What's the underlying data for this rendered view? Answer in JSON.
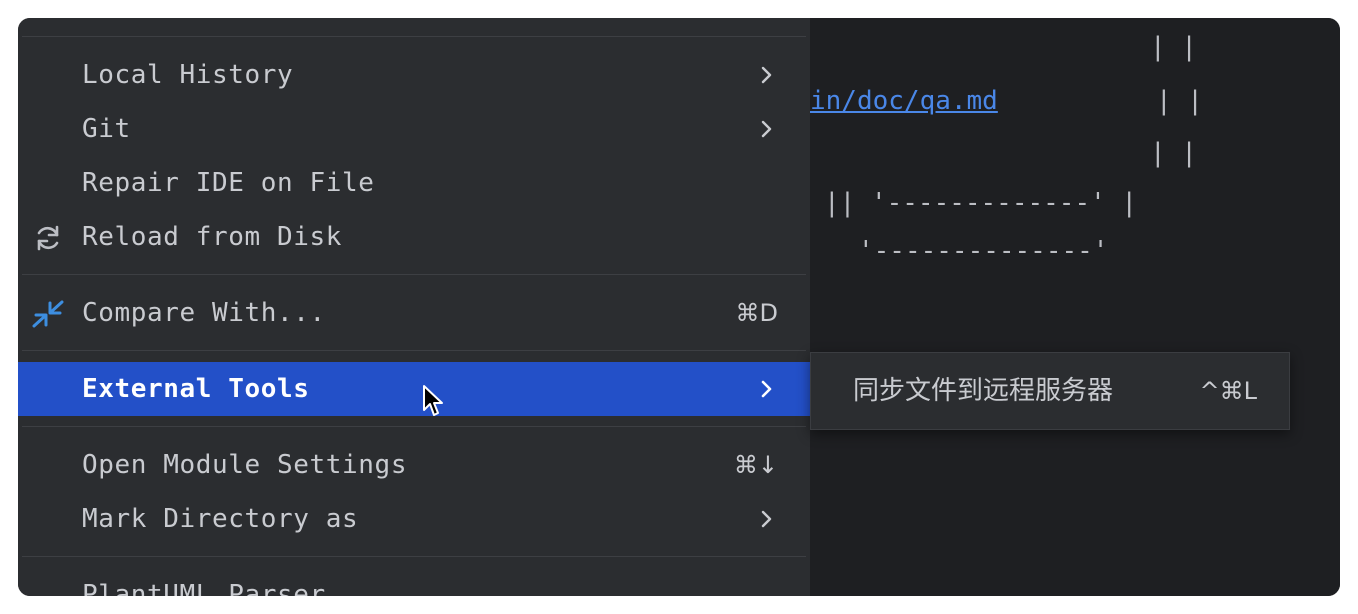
{
  "editor": {
    "lines": [
      "| |",
      "in/doc/qa.md",
      "| |",
      "| |",
      "|| '-------------' |",
      "'--------------'"
    ]
  },
  "menu": {
    "items": [
      {
        "label": "Local History",
        "has_submenu": true
      },
      {
        "label": "Git",
        "has_submenu": true
      },
      {
        "label": "Repair IDE on File"
      },
      {
        "label": "Reload from Disk",
        "icon": "refresh-icon"
      },
      {
        "label": "Compare With...",
        "icon": "compare-icon",
        "shortcut": "⌘D"
      },
      {
        "label": "External Tools",
        "has_submenu": true,
        "active": true
      },
      {
        "label": "Open Module Settings",
        "shortcut": "⌘↓"
      },
      {
        "label": "Mark Directory as",
        "has_submenu": true
      },
      {
        "label": "PlantUML Parser"
      }
    ]
  },
  "submenu": {
    "items": [
      {
        "label": "同步文件到远程服务器",
        "shortcut": "^⌘L"
      }
    ]
  },
  "colors": {
    "menu_bg": "#2b2d30",
    "selection": "#2350c8",
    "editor_bg": "#1e1f22",
    "link": "#4a87e8",
    "refresh_icon": "#bcbec4",
    "compare_icon": "#3d8ee0"
  }
}
